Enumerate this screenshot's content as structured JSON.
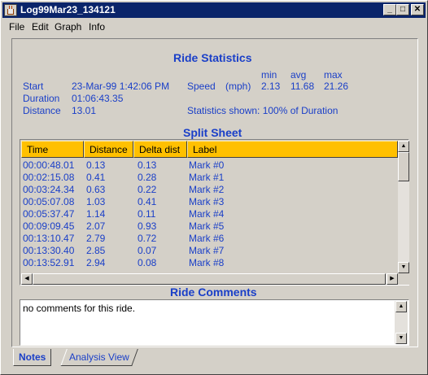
{
  "window": {
    "title": "Log99Mar23_134121"
  },
  "menu": [
    "File",
    "Edit",
    "Graph",
    "Info"
  ],
  "ride_statistics": {
    "heading": "Ride Statistics",
    "start_label": "Start",
    "start_value": "23-Mar-99 1:42:06 PM",
    "duration_label": "Duration",
    "duration_value": "01:06:43.35",
    "distance_label": "Distance",
    "distance_value": "13.01",
    "speed_label": "Speed",
    "speed_unit": "(mph)",
    "col_min": "min",
    "col_avg": "avg",
    "col_max": "max",
    "speed_min": "2.13",
    "speed_avg": "11.68",
    "speed_max": "21.26",
    "shown_note": "Statistics shown: 100% of Duration"
  },
  "split_sheet": {
    "heading": "Split Sheet",
    "columns": [
      "Time",
      "Distance",
      "Delta dist",
      "Label"
    ],
    "rows": [
      [
        "00:00:48.01",
        "0.13",
        "0.13",
        "Mark #0"
      ],
      [
        "00:02:15.08",
        "0.41",
        "0.28",
        "Mark #1"
      ],
      [
        "00:03:24.34",
        "0.63",
        "0.22",
        "Mark #2"
      ],
      [
        "00:05:07.08",
        "1.03",
        "0.41",
        "Mark #3"
      ],
      [
        "00:05:37.47",
        "1.14",
        "0.11",
        "Mark #4"
      ],
      [
        "00:09:09.45",
        "2.07",
        "0.93",
        "Mark #5"
      ],
      [
        "00:13:10.47",
        "2.79",
        "0.72",
        "Mark #6"
      ],
      [
        "00:13:30.40",
        "2.85",
        "0.07",
        "Mark #7"
      ],
      [
        "00:13:52.91",
        "2.94",
        "0.08",
        "Mark #8"
      ]
    ]
  },
  "ride_comments": {
    "heading": "Ride Comments",
    "text": "no comments for this ride."
  },
  "tabs": [
    {
      "label": "Notes",
      "active": true
    },
    {
      "label": "Analysis View",
      "active": false
    }
  ],
  "colors": {
    "accent": "#1a3fc8",
    "header": "#ffc000",
    "titlebar": "#0a246a",
    "face": "#d4d0c8"
  }
}
